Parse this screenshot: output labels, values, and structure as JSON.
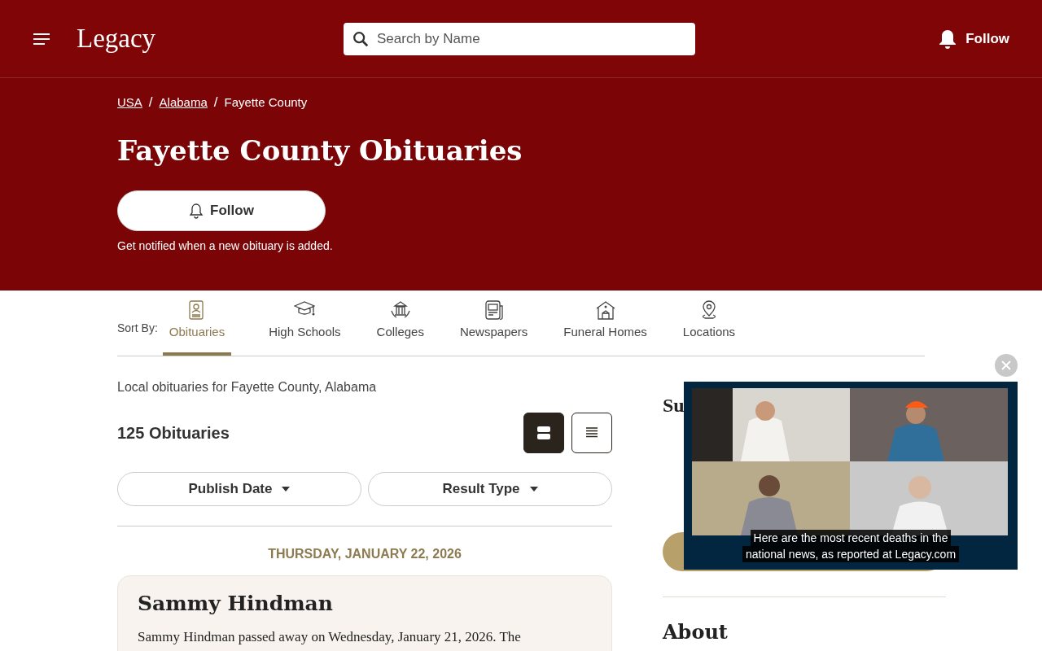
{
  "header": {
    "logo": "Legacy",
    "search": {
      "placeholder": "Search by Name"
    },
    "follow": "Follow"
  },
  "breadcrumbs": [
    {
      "label": "USA",
      "link": true
    },
    {
      "label": "Alabama",
      "link": true
    },
    {
      "label": "Fayette County",
      "link": false
    }
  ],
  "breadcrumb_separator": "/",
  "title": "Fayette County Obituaries",
  "follow_button": "Follow",
  "follow_note": "Get notified when a new obituary is added.",
  "sort": {
    "label": "Sort By:",
    "tabs": [
      {
        "label": "Obituaries",
        "kind": "person",
        "selected": true
      },
      {
        "label": "High Schools",
        "kind": "school",
        "selected": false
      },
      {
        "label": "Colleges",
        "kind": "college",
        "selected": false
      },
      {
        "label": "Newspapers",
        "kind": "newspaper",
        "selected": false
      },
      {
        "label": "Funeral Homes",
        "kind": "funeral",
        "selected": false
      },
      {
        "label": "Locations",
        "kind": "location",
        "selected": false
      }
    ]
  },
  "intro": "Local obituaries for Fayette County, Alabama",
  "count": "125 Obituaries",
  "views": [
    {
      "kind": "cards",
      "selected": true
    },
    {
      "kind": "list",
      "selected": false
    }
  ],
  "filters": [
    "Publish Date",
    "Result Type"
  ],
  "date_heading": "THURSDAY, JANUARY 22, 2026",
  "obituaries": [
    {
      "name": "Sammy Hindman",
      "text": "Sammy Hindman passed away on Wednesday, January 21, 2026. The"
    }
  ],
  "sidebar": {
    "heading": "Su",
    "about": "About"
  },
  "video": {
    "caption": [
      "Here are the most recent deaths in the",
      "national news, as reported at Legacy.com"
    ]
  }
}
